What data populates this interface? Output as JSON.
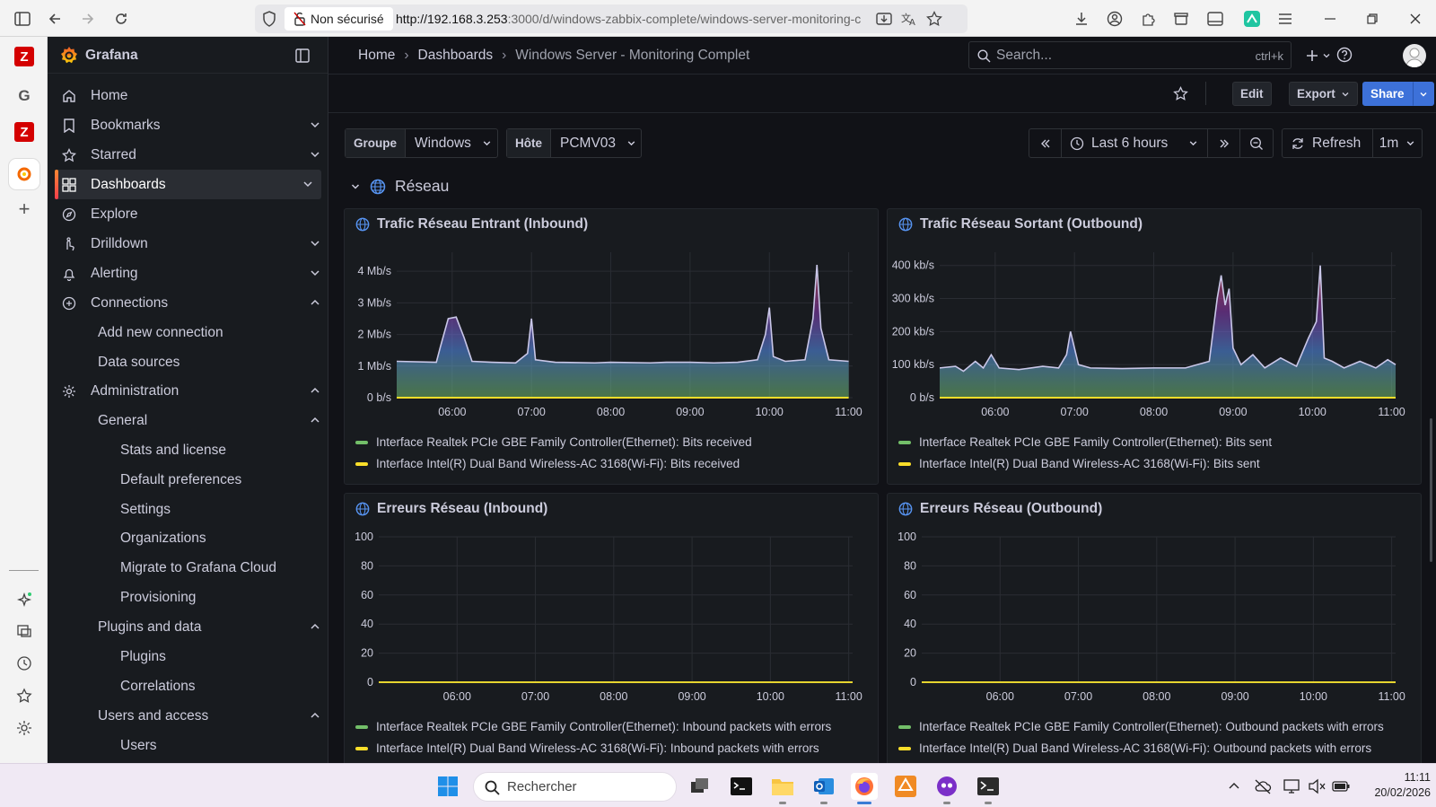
{
  "browser": {
    "insecure_label": "Non sécurisé",
    "url_host": "http://192.168.3.253",
    "url_rest": ":3000/d/windows-zabbix-complete/windows-server-monitoring-c"
  },
  "app": {
    "name": "Grafana",
    "search_placeholder": "Search...",
    "search_shortcut": "ctrl+k"
  },
  "breadcrumb": [
    "Home",
    "Dashboards",
    "Windows Server - Monitoring Complet"
  ],
  "toolbar": {
    "edit": "Edit",
    "export": "Export",
    "share": "Share"
  },
  "sidebar": {
    "items": [
      {
        "label": "Home",
        "icon": "home-icon",
        "chevron": ""
      },
      {
        "label": "Bookmarks",
        "icon": "bookmark-icon",
        "chevron": "down"
      },
      {
        "label": "Starred",
        "icon": "star-icon",
        "chevron": "down"
      },
      {
        "label": "Dashboards",
        "icon": "grid-icon",
        "chevron": "down",
        "active": true
      },
      {
        "label": "Explore",
        "icon": "compass-icon",
        "chevron": ""
      },
      {
        "label": "Drilldown",
        "icon": "drilldown-icon",
        "chevron": "down"
      },
      {
        "label": "Alerting",
        "icon": "bell-icon",
        "chevron": "down"
      },
      {
        "label": "Connections",
        "icon": "connections-icon",
        "chevron": "up"
      }
    ],
    "connections_children": [
      "Add new connection",
      "Data sources"
    ],
    "administration": "Administration",
    "general": "General",
    "general_children": [
      "Stats and license",
      "Default preferences",
      "Settings",
      "Organizations",
      "Migrate to Grafana Cloud",
      "Provisioning"
    ],
    "plugins_and_data": "Plugins and data",
    "plugins_children": [
      "Plugins",
      "Correlations"
    ],
    "users_and_access": "Users and access",
    "users_children": [
      "Users"
    ]
  },
  "variables": {
    "groupe_label": "Groupe",
    "groupe_value": "Windows",
    "hote_label": "Hôte",
    "hote_value": "PCMV03"
  },
  "time": {
    "range": "Last 6 hours",
    "refresh": "Refresh",
    "interval": "1m"
  },
  "row_title": "Réseau",
  "colors": {
    "green": "#73bf69",
    "yellow": "#fade2a",
    "accent": "#3d71d9",
    "orange": "#f46800"
  },
  "chart_data": [
    {
      "type": "line",
      "title": "Trafic Réseau Entrant (Inbound)",
      "x_ticks": [
        "06:00",
        "07:00",
        "08:00",
        "09:00",
        "10:00",
        "11:00"
      ],
      "y_ticks": [
        "0 b/s",
        "1 Mb/s",
        "2 Mb/s",
        "3 Mb/s",
        "4 Mb/s"
      ],
      "ylim": [
        0,
        4.6
      ],
      "xlim": [
        5.3,
        11.05
      ],
      "series": [
        {
          "name": "Interface Realtek PCIe GBE Family Controller(Ethernet): Bits received",
          "color": "#73bf69",
          "x": [
            5.3,
            5.8,
            5.85,
            5.95,
            6.05,
            6.15,
            6.25,
            6.5,
            6.8,
            6.95,
            7.0,
            7.05,
            7.3,
            7.8,
            8.0,
            8.5,
            8.7,
            9.0,
            9.3,
            9.6,
            9.85,
            9.95,
            10.0,
            10.05,
            10.2,
            10.45,
            10.55,
            10.6,
            10.65,
            10.75,
            11.0
          ],
          "y": [
            1.15,
            1.12,
            1.6,
            2.5,
            2.55,
            1.9,
            1.15,
            1.12,
            1.1,
            1.4,
            2.5,
            1.2,
            1.12,
            1.1,
            1.12,
            1.1,
            1.12,
            1.12,
            1.1,
            1.12,
            1.2,
            2.0,
            2.85,
            1.3,
            1.15,
            1.2,
            2.5,
            4.2,
            2.2,
            1.2,
            1.15
          ]
        },
        {
          "name": "Interface Intel(R) Dual Band Wireless-AC 3168(Wi-Fi): Bits received",
          "color": "#fade2a",
          "x": [
            5.3,
            11.0
          ],
          "y": [
            0,
            0
          ]
        }
      ]
    },
    {
      "type": "line",
      "title": "Trafic Réseau Sortant (Outbound)",
      "x_ticks": [
        "06:00",
        "07:00",
        "08:00",
        "09:00",
        "10:00",
        "11:00"
      ],
      "y_ticks": [
        "0 b/s",
        "100 kb/s",
        "200 kb/s",
        "300 kb/s",
        "400 kb/s"
      ],
      "ylim": [
        0,
        440
      ],
      "xlim": [
        5.3,
        11.05
      ],
      "series": [
        {
          "name": "Interface Realtek PCIe GBE Family Controller(Ethernet): Bits sent",
          "color": "#73bf69",
          "x": [
            5.3,
            5.5,
            5.6,
            5.75,
            5.85,
            5.95,
            6.05,
            6.3,
            6.6,
            6.8,
            6.9,
            6.95,
            7.05,
            7.2,
            7.6,
            8.0,
            8.4,
            8.7,
            8.8,
            8.85,
            8.9,
            8.95,
            9.0,
            9.1,
            9.25,
            9.4,
            9.6,
            9.8,
            9.95,
            10.05,
            10.1,
            10.15,
            10.25,
            10.4,
            10.6,
            10.8,
            10.95,
            11.05
          ],
          "y": [
            90,
            95,
            80,
            110,
            90,
            130,
            90,
            85,
            95,
            90,
            130,
            200,
            100,
            90,
            88,
            90,
            90,
            110,
            300,
            370,
            280,
            330,
            150,
            100,
            130,
            90,
            120,
            95,
            180,
            230,
            400,
            120,
            110,
            90,
            110,
            90,
            115,
            100
          ]
        },
        {
          "name": "Interface Intel(R) Dual Band Wireless-AC 3168(Wi-Fi): Bits sent",
          "color": "#fade2a",
          "x": [
            5.3,
            11.05
          ],
          "y": [
            0,
            0
          ]
        }
      ]
    },
    {
      "type": "line",
      "title": "Erreurs Réseau (Inbound)",
      "x_ticks": [
        "06:00",
        "07:00",
        "08:00",
        "09:00",
        "10:00",
        "11:00"
      ],
      "y_ticks": [
        "0",
        "20",
        "40",
        "60",
        "80",
        "100"
      ],
      "ylim": [
        0,
        100
      ],
      "xlim": [
        5.0,
        11.05
      ],
      "series": [
        {
          "name": "Interface Realtek PCIe GBE Family Controller(Ethernet): Inbound packets with errors",
          "color": "#73bf69",
          "x": [
            5.0,
            11.05
          ],
          "y": [
            0,
            0
          ]
        },
        {
          "name": "Interface Intel(R) Dual Band Wireless-AC 3168(Wi-Fi): Inbound packets with errors",
          "color": "#fade2a",
          "x": [
            5.0,
            11.05
          ],
          "y": [
            0,
            0
          ]
        }
      ]
    },
    {
      "type": "line",
      "title": "Erreurs Réseau (Outbound)",
      "x_ticks": [
        "06:00",
        "07:00",
        "08:00",
        "09:00",
        "10:00",
        "11:00"
      ],
      "y_ticks": [
        "0",
        "20",
        "40",
        "60",
        "80",
        "100"
      ],
      "ylim": [
        0,
        100
      ],
      "xlim": [
        5.0,
        11.05
      ],
      "series": [
        {
          "name": "Interface Realtek PCIe GBE Family Controller(Ethernet): Outbound packets with errors",
          "color": "#73bf69",
          "x": [
            5.0,
            11.05
          ],
          "y": [
            0,
            0
          ]
        },
        {
          "name": "Interface Intel(R) Dual Band Wireless-AC 3168(Wi-Fi): Outbound packets with errors",
          "color": "#fade2a",
          "x": [
            5.0,
            11.05
          ],
          "y": [
            0,
            0
          ]
        }
      ]
    }
  ],
  "taskbar": {
    "search_placeholder": "Rechercher",
    "time": "11:11",
    "date": "20/02/2026"
  }
}
